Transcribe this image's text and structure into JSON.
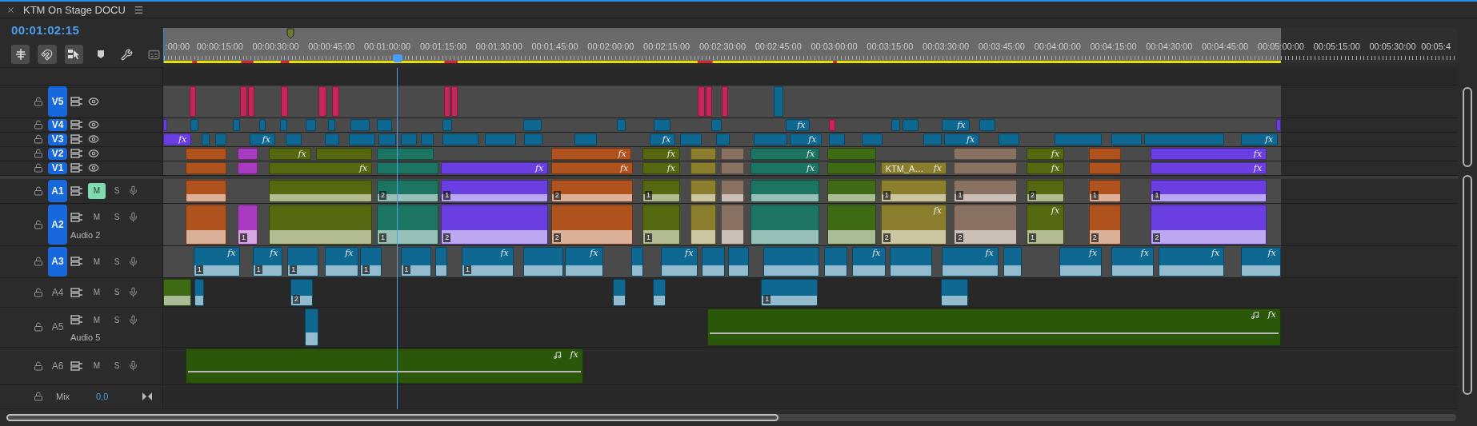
{
  "panel": {
    "title": "KTM On Stage DOCU"
  },
  "timecode": "00:01:02:15",
  "ruler": {
    "labels": [
      ":00:00",
      "00:00:15:00",
      "00:00:30:00",
      "00:00:45:00",
      "00:01:00:00",
      "00:01:15:00",
      "00:01:30:00",
      "00:01:45:00",
      "00:02:00:00",
      "00:02:15:00",
      "00:02:30:00",
      "00:02:45:00",
      "00:03:00:00",
      "00:03:15:00",
      "00:03:30:00",
      "00:03:45:00",
      "00:04:00:00",
      "00:04:15:00",
      "00:04:30:00",
      "00:04:45:00",
      "00:05:00:00",
      "00:05:15:00",
      "00:05:30:00",
      "00:05:4"
    ]
  },
  "tracks": [
    {
      "name": "V5",
      "kind": "video",
      "targeted": true,
      "clips": [
        {
          "color": "#c42659"
        },
        {
          "color": "#c42659"
        },
        {
          "color": "#c42659"
        },
        {
          "color": "#c42659"
        },
        {
          "color": "#c42659"
        },
        {
          "color": "#c42659"
        },
        {
          "color": "#c42659"
        },
        {
          "color": "#c42659"
        },
        {
          "color": "#c42659"
        },
        {
          "color": "#c42659"
        },
        {
          "color": "#c42659"
        },
        {
          "color": "#0e6892"
        }
      ]
    },
    {
      "name": "V4",
      "kind": "video",
      "targeted": true,
      "clips": [
        {
          "color": "#6a3ee0"
        },
        {
          "color": "#0e6892"
        },
        {
          "color": "#0e6892"
        },
        {
          "color": "#0e6892"
        },
        {
          "color": "#0e6892"
        },
        {
          "color": "#0e6892"
        },
        {
          "color": "#0e6892"
        },
        {
          "color": "#0e6892"
        },
        {
          "color": "#0e6892"
        },
        {
          "color": "#0e6892"
        },
        {
          "color": "#0e6892"
        },
        {
          "color": "#0e6892"
        },
        {
          "color": "#0e6892"
        },
        {
          "color": "#0e6892"
        },
        {
          "color": "#0e6892",
          "effect": "fx"
        },
        {
          "color": "#c42659"
        },
        {
          "color": "#0e6892"
        },
        {
          "color": "#0e6892"
        },
        {
          "color": "#0e6892",
          "effect": "fx"
        },
        {
          "color": "#0e6892"
        },
        {
          "color": "#6a3ee0"
        }
      ]
    },
    {
      "name": "V3",
      "kind": "video",
      "targeted": true,
      "clips": [
        {
          "color": "#6a3ee0",
          "effect": "fx"
        },
        {
          "color": "#0e6892"
        },
        {
          "color": "#0e6892"
        },
        {
          "color": "#0e6892",
          "effect": "fx"
        },
        {
          "color": "#0e6892"
        },
        {
          "color": "#0e6892"
        },
        {
          "color": "#0e6892"
        },
        {
          "color": "#0e6892"
        },
        {
          "color": "#0e6892"
        },
        {
          "color": "#0e6892"
        },
        {
          "color": "#0e6892"
        },
        {
          "color": "#0e6892"
        },
        {
          "color": "#0e6892"
        },
        {
          "color": "#0e6892"
        },
        {
          "color": "#0e6892",
          "effect": "fx"
        },
        {
          "color": "#0e6892"
        },
        {
          "color": "#0e6892"
        },
        {
          "color": "#0e6892"
        },
        {
          "color": "#0e6892",
          "effect": "fx"
        },
        {
          "color": "#0e6892"
        },
        {
          "color": "#0e6892"
        },
        {
          "color": "#0e6892"
        },
        {
          "color": "#0e6892",
          "effect": "fx"
        },
        {
          "color": "#0e6892"
        },
        {
          "color": "#0e6892"
        },
        {
          "color": "#0e6892"
        },
        {
          "color": "#0e6892"
        },
        {
          "color": "#0e6892",
          "effect": "fx"
        }
      ]
    },
    {
      "name": "V2",
      "kind": "video",
      "targeted": true,
      "clips": [
        {
          "color": "#b0521d"
        },
        {
          "color": "#a83bbf"
        },
        {
          "color": "#55680f",
          "effect": "fx"
        },
        {
          "color": "#55680f"
        },
        {
          "color": "#1c7462"
        },
        {
          "color": "#b0521d",
          "effect": "fx"
        },
        {
          "color": "#55680f",
          "effect": "fx"
        },
        {
          "color": "#8b7f2d"
        },
        {
          "color": "#8a7262"
        },
        {
          "color": "#1c7462",
          "effect": "fx"
        },
        {
          "color": "#3f6a14"
        },
        {
          "color": "#8a7262"
        },
        {
          "color": "#55680f",
          "effect": "fx"
        },
        {
          "color": "#b0521d"
        },
        {
          "color": "#6a3ee0",
          "effect": "fx"
        }
      ]
    },
    {
      "name": "V1",
      "kind": "video",
      "targeted": true,
      "clips": [
        {
          "color": "#b0521d"
        },
        {
          "color": "#a83bbf"
        },
        {
          "color": "#55680f",
          "effect": "fx"
        },
        {
          "color": "#1c7462"
        },
        {
          "color": "#6a3ee0",
          "effect": "fx"
        },
        {
          "color": "#b0521d",
          "effect": "fx"
        },
        {
          "color": "#55680f",
          "effect": "fx"
        },
        {
          "color": "#8b7f2d"
        },
        {
          "color": "#8a7262"
        },
        {
          "color": "#1c7462",
          "effect": "fx"
        },
        {
          "color": "#3f6a14"
        },
        {
          "color": "#8b7f2d",
          "name": "KTM_A…",
          "effect": "fx"
        },
        {
          "color": "#8a7262"
        },
        {
          "color": "#55680f",
          "effect": "fx"
        },
        {
          "color": "#b0521d"
        },
        {
          "color": "#6a3ee0",
          "effect": "fx"
        }
      ]
    },
    {
      "name": "A1",
      "kind": "audio",
      "targeted": true,
      "muted": true,
      "mute_label": "M",
      "solo_label": "S",
      "clips": [
        {
          "color": "#b0521d"
        },
        {
          "color": "#55680f"
        },
        {
          "color": "#1c7462",
          "channel": "2"
        },
        {
          "color": "#6a3ee0",
          "channel": "1"
        },
        {
          "color": "#b0521d",
          "channel": "2"
        },
        {
          "color": "#55680f",
          "channel": "1"
        },
        {
          "color": "#8b7f2d"
        },
        {
          "color": "#8a7262"
        },
        {
          "color": "#1c7462"
        },
        {
          "color": "#3f6a14"
        },
        {
          "color": "#8b7f2d",
          "channel": "1"
        },
        {
          "color": "#8a7262",
          "channel": "1"
        },
        {
          "color": "#55680f",
          "channel": "2"
        },
        {
          "color": "#b0521d",
          "channel": "1"
        },
        {
          "color": "#6a3ee0",
          "channel": "1"
        }
      ]
    },
    {
      "name": "A2",
      "kind": "audio",
      "targeted": true,
      "muted": false,
      "mute_label": "M",
      "solo_label": "S",
      "title": "Audio 2",
      "clips": [
        {
          "color": "#b0521d"
        },
        {
          "color": "#a83bbf",
          "channel": "1"
        },
        {
          "color": "#55680f"
        },
        {
          "color": "#1c7462",
          "channel": "1"
        },
        {
          "color": "#6a3ee0",
          "channel": "2"
        },
        {
          "color": "#b0521d",
          "channel": "2"
        },
        {
          "color": "#55680f",
          "channel": "1"
        },
        {
          "color": "#8b7f2d"
        },
        {
          "color": "#8a7262"
        },
        {
          "color": "#1c7462"
        },
        {
          "color": "#3f6a14"
        },
        {
          "color": "#8b7f2d",
          "effect": "fx",
          "channel": "2"
        },
        {
          "color": "#8a7262",
          "channel": "2"
        },
        {
          "color": "#55680f",
          "effect": "fx",
          "channel": "1"
        },
        {
          "color": "#b0521d",
          "channel": "2"
        },
        {
          "color": "#6a3ee0",
          "channel": "2"
        }
      ]
    },
    {
      "name": "A3",
      "kind": "audio",
      "targeted": true,
      "muted": false,
      "mute_label": "M",
      "solo_label": "S",
      "clips": [
        {
          "color": "#0e6892",
          "effect": "fx",
          "channel": "1"
        },
        {
          "color": "#0e6892",
          "effect": "fx",
          "channel": "1"
        },
        {
          "color": "#0e6892",
          "channel": "1"
        },
        {
          "color": "#0e6892",
          "effect": "fx"
        },
        {
          "color": "#0e6892",
          "channel": "1"
        },
        {
          "color": "#0e6892",
          "channel": "1"
        },
        {
          "color": "#0e6892"
        },
        {
          "color": "#0e6892",
          "effect": "fx",
          "channel": "1"
        },
        {
          "color": "#0e6892"
        },
        {
          "color": "#0e6892",
          "effect": "fx"
        },
        {
          "color": "#0e6892"
        },
        {
          "color": "#0e6892",
          "effect": "fx"
        },
        {
          "color": "#0e6892"
        },
        {
          "color": "#0e6892"
        },
        {
          "color": "#0e6892"
        },
        {
          "color": "#0e6892"
        },
        {
          "color": "#0e6892",
          "effect": "fx"
        },
        {
          "color": "#0e6892"
        },
        {
          "color": "#0e6892",
          "effect": "fx"
        },
        {
          "color": "#0e6892"
        },
        {
          "color": "#0e6892",
          "effect": "fx"
        },
        {
          "color": "#0e6892",
          "effect": "fx"
        },
        {
          "color": "#0e6892",
          "effect": "fx"
        },
        {
          "color": "#0e6892",
          "effect": "fx"
        }
      ]
    },
    {
      "name": "A4",
      "kind": "audio",
      "targeted": false,
      "muted": false,
      "mute_label": "M",
      "solo_label": "S",
      "clips": [
        {
          "color": "#3f6a14"
        },
        {
          "color": "#0e6892"
        },
        {
          "color": "#0e6892",
          "channel": "2"
        },
        {
          "color": "#0e6892"
        },
        {
          "color": "#0e6892"
        },
        {
          "color": "#0e6892",
          "channel": "1"
        },
        {
          "color": "#0e6892"
        }
      ]
    },
    {
      "name": "A5",
      "kind": "audio",
      "targeted": false,
      "muted": false,
      "mute_label": "M",
      "solo_label": "S",
      "title": "Audio 5",
      "clips": [
        {
          "color": "#0e6892"
        },
        {
          "color": "#2b570b",
          "effect": "fx",
          "music": true
        }
      ]
    },
    {
      "name": "A6",
      "kind": "audio",
      "targeted": false,
      "muted": false,
      "mute_label": "M",
      "solo_label": "S",
      "clips": [
        {
          "color": "#2b570b",
          "effect": "fx",
          "music": true
        }
      ]
    }
  ],
  "mix": {
    "name": "Mix",
    "volume": "0,0"
  }
}
